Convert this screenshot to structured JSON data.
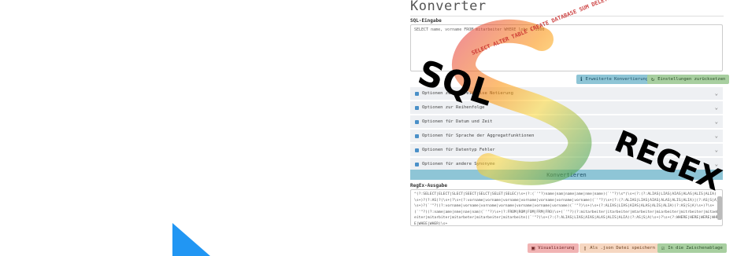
{
  "header": {
    "title": "Konverter"
  },
  "sql": {
    "label": "SQL-Eingabe",
    "value": "SELECT name, vorname FROM mitarbeiter WHERE lohn > 1000"
  },
  "input_actions": {
    "visualize_label": "Erweiterte Konvertierung",
    "reset_label": "Einstellungen zurücksetzen"
  },
  "options": [
    {
      "label": "Optionen zur Schreibweise Notierung"
    },
    {
      "label": "Optionen zur Reihenfolge"
    },
    {
      "label": "Optionen für Datum und Zeit"
    },
    {
      "label": "Optionen für Sprache der Aggregatfunktionen"
    },
    {
      "label": "Optionen für Datentyp Fehler"
    },
    {
      "label": "Optionen für andere Synonyme"
    }
  ],
  "convert": {
    "label": "Konvertieren"
  },
  "regex": {
    "label": "RegEx-Ausgabe",
    "value": "^(?:SELECT|ELECT|SLECT|SEECT|SELCT|SELET|SELEC)\\s+(?:(`'\"?)name|nam|name|ame|nme|name)(`'\"?)\\s*(\\s+(?:(?:ALIAS|LIAS|AIAS|ALAS|ALIS|ALIA)\\s+)?(?:AS)?(\\s+)?\\s+(?:vorname|vorname|vorname|vorname|vorname|vorname|vorname)(`'\"?)\\s+(?:(?:ALIAS|LIAS|AIAS|ALAS|ALIS|ALIA)|(?:AS|S|A)\\s+)?(`'\"?)(?:vorname|vorname|vorname|vorname|vorname|vorname|vorname)(`'\"?)\\s+(\\s+(?:ALIAS|LIAS|AIAS|ALAS|ALIS|ALIA)(?:AS|S|A)\\s+)?\\s+(`'\"?)(?:name|ame|nme|nae|nam)(`'\"?)\\s+(?:FROM|ROM|FOM|FRM|FRO)\\s+(`'\"?)(?:mitarbeiter|itarbeiter|mtarbeiter|miarbeiter|mitrbeiter|mitaebeiter|mitarbiter|mitarbeter|mitarbeiter|mitarbeite)(`'\"?)\\s+(?:(?:ALIAS|LIAS|AIAS|ALAS|ALIS|ALIA)(?:AS|S|A)\\s+)?\\s+(?:WHERE|HERE|WERE|WHRE|WHEE|WHER)\\s+"
  },
  "output_actions": {
    "visualize_label": "Visualisierung",
    "save_label": "Als .json Datei speichern",
    "copy_label": "In die Zwischenablage"
  },
  "logo": {
    "word_sql": "SQL",
    "word_regex": "REGEX",
    "tiles": "SELECT ALTER TABLE CREATE DATABASE SUM DELETE AVG GROUP BY WHERE INSERT UPDATE JOIN ORDER BY",
    "accent_colors": [
      "#e53935",
      "#fb8c00",
      "#fdd835",
      "#43a047"
    ]
  },
  "colors": {
    "accent_blue": "#8ec5d6",
    "accent_green": "#a8cfa0",
    "triangle": "#2196f3"
  }
}
